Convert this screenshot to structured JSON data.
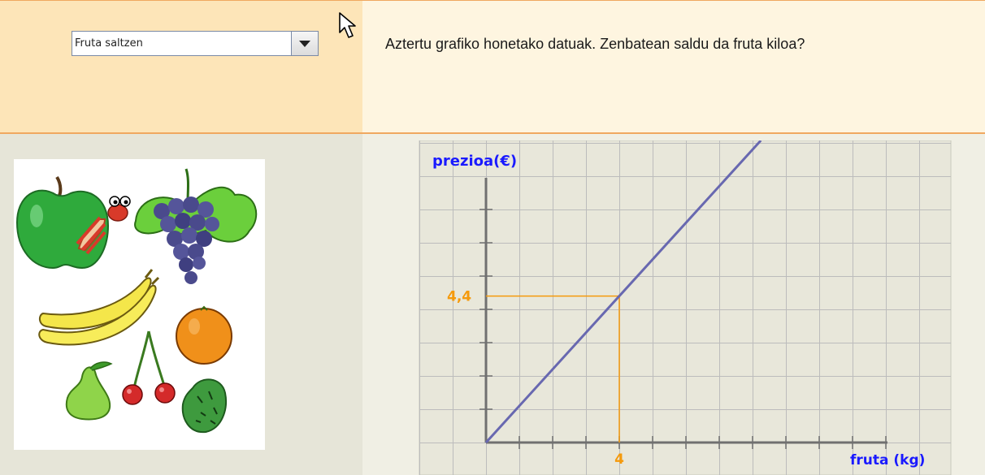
{
  "dropdown": {
    "selected": "Fruta saltzen"
  },
  "question": "Aztertu grafiko honetako datuak. Zenbatean saldu da fruta kiloa?",
  "fruit_image": {
    "items": [
      "apple-with-worm",
      "grapes",
      "bananas",
      "orange",
      "pear",
      "cherries",
      "kiwi"
    ]
  },
  "colors": {
    "line": "#6868b0",
    "guide": "#f59a0c",
    "label_blue": "#1a1aff",
    "grid": "#bcbcbc"
  },
  "chart_data": {
    "type": "line",
    "xlabel": "fruta (kg)",
    "ylabel": "prezioa(€)",
    "series": [
      {
        "x": [
          0,
          4
        ],
        "y": [
          0,
          4.4
        ]
      }
    ],
    "highlight": {
      "x": 4,
      "y": 4.4,
      "x_label": "4",
      "y_label": "4,4"
    },
    "grid": true
  }
}
